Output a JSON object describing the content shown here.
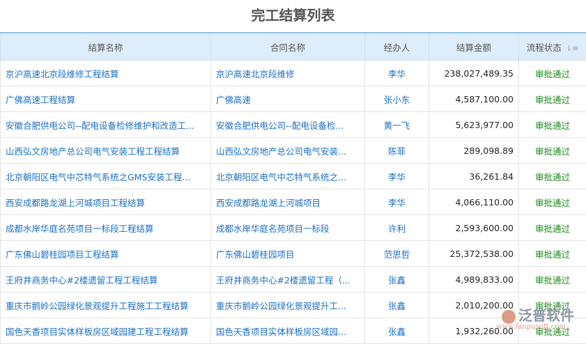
{
  "title": "完工结算列表",
  "columns": [
    "结算名称",
    "合同名称",
    "经办人",
    "结算金额",
    "流程状态"
  ],
  "rows": [
    [
      "京沪高速北京段维修工程结算",
      "京沪高速北京段维修",
      "李华",
      "238,027,489.35",
      "审批通过"
    ],
    [
      "广佛高速工程结算",
      "广佛高速",
      "张小东",
      "4,587,100.00",
      "审批通过"
    ],
    [
      "安徽合肥供电公司--配电设备检修维护和改造工...",
      "安徽合肥供电公司--配电设备检...",
      "黄一飞",
      "5,623,977.00",
      "审批通过"
    ],
    [
      "山西弘文房地产总公司电气安装工程工程结算",
      "山西弘文房地产总公司电气安装...",
      "陈菲",
      "289,098.89",
      "审批通过"
    ],
    [
      "北京朝阳区电气中芯特气系统之GMS安装工程...",
      "北京朝阳区电气中芯特气系统之...",
      "李华",
      "36,261.84",
      "审批通过"
    ],
    [
      "西安成都路龙湖上河城项目工程结算",
      "西安成都路龙湖上河城项目",
      "李华",
      "4,066,110.00",
      "审批通过"
    ],
    [
      "成都水岸华庭名苑项目一标段工程结算",
      "成都水岸华庭名苑项目一标段",
      "许利",
      "2,593,600.00",
      "审批通过"
    ],
    [
      "广东佛山碧桂园项目工程结算",
      "广东佛山碧桂园项目",
      "范思哲",
      "25,372,538.00",
      "审批通过"
    ],
    [
      "王府井商务中心#2楼遗留工程工程结算",
      "王府井商务中心#2楼遗留工程（...",
      "张鑫",
      "4,989,833.00",
      "审批通过"
    ],
    [
      "重庆市鹅岭公园绿化景观提升工程施工工程结算",
      "重庆市鹅岭公园绿化景观提升工...",
      "张鑫",
      "2,010,200.00",
      "审批通过"
    ],
    [
      "国色天香项目实体样板房区域园建工程工程结算",
      "国色天香项目实体样板房区域园...",
      "张鑫",
      "1,932,260.00",
      "审批通过"
    ]
  ],
  "watermark": {
    "brand": "泛普软件",
    "url": "www.fanpusoft.com"
  }
}
